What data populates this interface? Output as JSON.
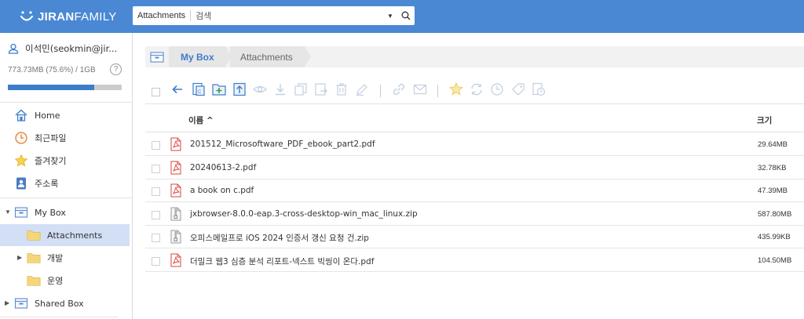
{
  "header": {
    "brand_bold": "JIRAN",
    "brand_light": "FAMILY",
    "search_scope": "Attachments",
    "search_placeholder": "검색"
  },
  "sidebar": {
    "user": "이석민(seokmin@jir...",
    "quota_text": "773.73MB (75.6%) / 1GB",
    "quota_fraction": 0.756,
    "help": "?",
    "items": [
      {
        "label": "Home",
        "icon": "home-icon"
      },
      {
        "label": "최근파일",
        "icon": "clock-icon"
      },
      {
        "label": "즐겨찾기",
        "icon": "star-icon"
      },
      {
        "label": "주소록",
        "icon": "contacts-icon"
      }
    ],
    "tree": [
      {
        "label": "My Box",
        "icon": "box-icon",
        "expanded": true
      },
      {
        "label": "Attachments",
        "icon": "folder-icon",
        "selected": true
      },
      {
        "label": "개발",
        "icon": "folder-icon",
        "expanded": false
      },
      {
        "label": "운영",
        "icon": "folder-icon"
      },
      {
        "label": "Shared Box",
        "icon": "box-icon",
        "expanded": false
      }
    ]
  },
  "breadcrumb": {
    "root": "My Box",
    "current": "Attachments"
  },
  "table": {
    "col_name": "이름 ^",
    "col_size": "크기",
    "rows": [
      {
        "name": "201512_Microsoftware_PDF_ebook_part2.pdf",
        "size": "29.64MB",
        "type": "pdf"
      },
      {
        "name": "20240613-2.pdf",
        "size": "32.78KB",
        "type": "pdf"
      },
      {
        "name": "a book on c.pdf",
        "size": "47.39MB",
        "type": "pdf"
      },
      {
        "name": "jxbrowser-8.0.0-eap.3-cross-desktop-win_mac_linux.zip",
        "size": "587.80MB",
        "type": "zip"
      },
      {
        "name": "오피스메일프로 iOS 2024 인증서 갱신 요청 건.zip",
        "size": "435.99KB",
        "type": "zip"
      },
      {
        "name": "더밀크 웹3 심층 분석 리포트-넥스트 빅씽이 온다.pdf",
        "size": "104.50MB",
        "type": "pdf"
      }
    ]
  },
  "colors": {
    "header_bg": "#4a88d4",
    "accent": "#3d7cc9",
    "selected_bg": "#d2dff5",
    "pdf_red": "#d9453b",
    "folder_yellow": "#f5d77a"
  }
}
